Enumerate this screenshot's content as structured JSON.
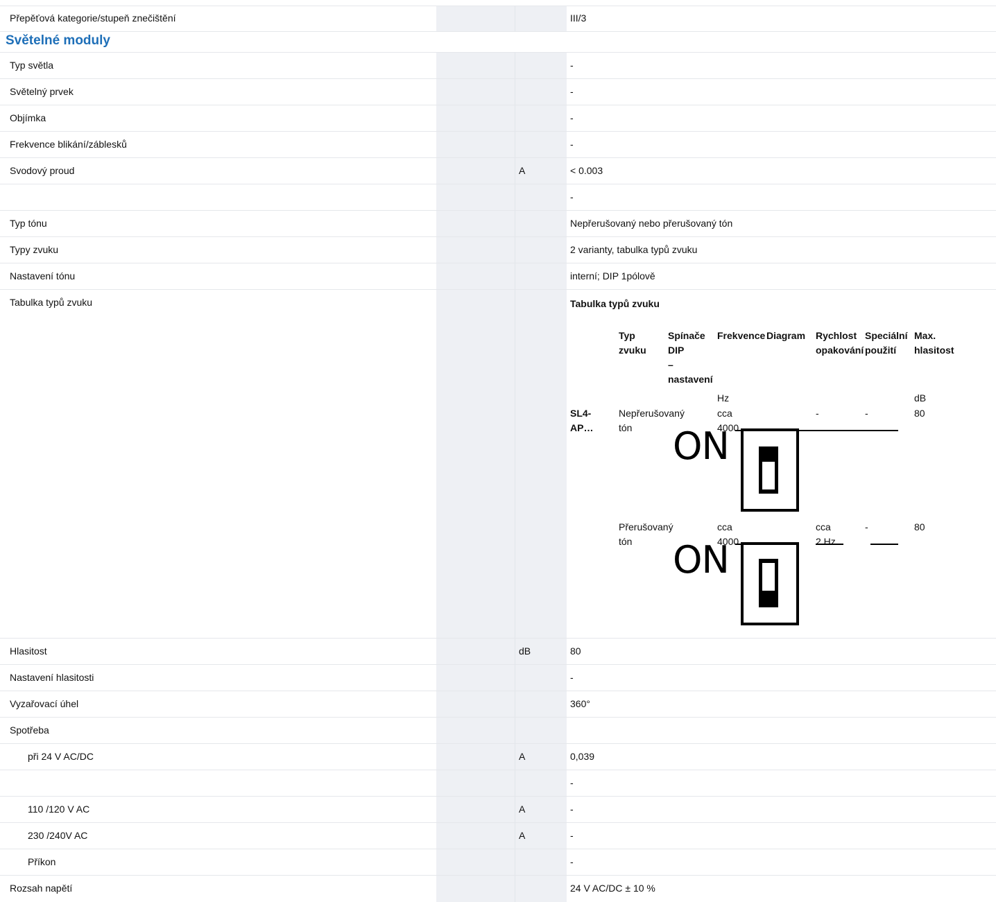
{
  "rows_top": [
    {
      "label": "Přepěťová kategorie/stupeň znečištění",
      "unit": "",
      "value": "III/3"
    }
  ],
  "section": {
    "title": "Světelné moduly"
  },
  "rows_mid": [
    {
      "label": "Typ světla",
      "unit": "",
      "value": "-"
    },
    {
      "label": "Světelný prvek",
      "unit": "",
      "value": "-"
    },
    {
      "label": "Objímka",
      "unit": "",
      "value": "-"
    },
    {
      "label": "Frekvence blikání/záblesků",
      "unit": "",
      "value": "-"
    },
    {
      "label": "Svodový proud",
      "unit": "A",
      "value": "< 0.003"
    },
    {
      "label": "",
      "unit": "",
      "value": "-"
    },
    {
      "label": "Typ tónu",
      "unit": "",
      "value": "Nepřerušovaný nebo přerušovaný tón"
    },
    {
      "label": "Typy zvuku",
      "unit": "",
      "value": "2 varianty, tabulka typů zvuku"
    },
    {
      "label": "Nastavení tónu",
      "unit": "",
      "value": "interní; DIP 1pólově"
    }
  ],
  "sound_table_row": {
    "label": "Tabulka typů zvuku",
    "title": "Tabulka typů zvuku",
    "headers": {
      "typ_line1": "Typ",
      "typ_line2": "zvuku",
      "dip_line1": "Spínače",
      "dip_line2": "DIP",
      "dip_line3": "–",
      "dip_line4": "nastavení",
      "freq": "Frekvence",
      "diagram": "Diagram",
      "rate_line1": "Rychlost",
      "rate_line2": "opakování",
      "special_line1": "Speciální",
      "special_line2": "použití",
      "max_line1": "Max.",
      "max_line2": "hlasitost"
    },
    "units": {
      "freq": "Hz",
      "max": "dB"
    },
    "product_line1": "SL4-",
    "product_line2": "AP…",
    "entries": [
      {
        "type_line1": "Nepřerušovaný",
        "type_line2": "tón",
        "freq_line1": "cca",
        "freq_line2": "4000",
        "dip_label": "ON",
        "dip_state": "on",
        "rate": "-",
        "special": "-",
        "max": "80"
      },
      {
        "type_line1": "Přerušovaný",
        "type_line2": "tón",
        "freq_line1": "cca",
        "freq_line2": "4000",
        "dip_label": "ON",
        "dip_state": "off",
        "rate_line1": "cca",
        "rate_line2": "2 Hz",
        "special": "-",
        "max": "80"
      }
    ]
  },
  "rows_bottom": [
    {
      "label": "Hlasitost",
      "unit": "dB",
      "value": "80"
    },
    {
      "label": "Nastavení hlasitosti",
      "unit": "",
      "value": "-"
    },
    {
      "label": "Vyzařovací úhel",
      "unit": "",
      "value": "360°"
    },
    {
      "label": "Spotřeba",
      "unit": "",
      "value": ""
    },
    {
      "label": "při 24 V AC/DC",
      "unit": "A",
      "value": "0,039",
      "indent": true
    },
    {
      "label": "",
      "unit": "",
      "value": "-"
    },
    {
      "label": "110 /120 V AC",
      "unit": "A",
      "value": "-",
      "indent": true
    },
    {
      "label": "230 /240V AC",
      "unit": "A",
      "value": "-",
      "indent": true
    },
    {
      "label": "Příkon",
      "unit": "",
      "value": "-",
      "indent": true
    },
    {
      "label": "Rozsah napětí",
      "unit": "",
      "value": "24 V AC/DC ± 10 %"
    }
  ],
  "colors": {
    "section_title": "#1e6fb8",
    "grey_column": "#eef0f4",
    "row_border": "#e5e7eb"
  }
}
